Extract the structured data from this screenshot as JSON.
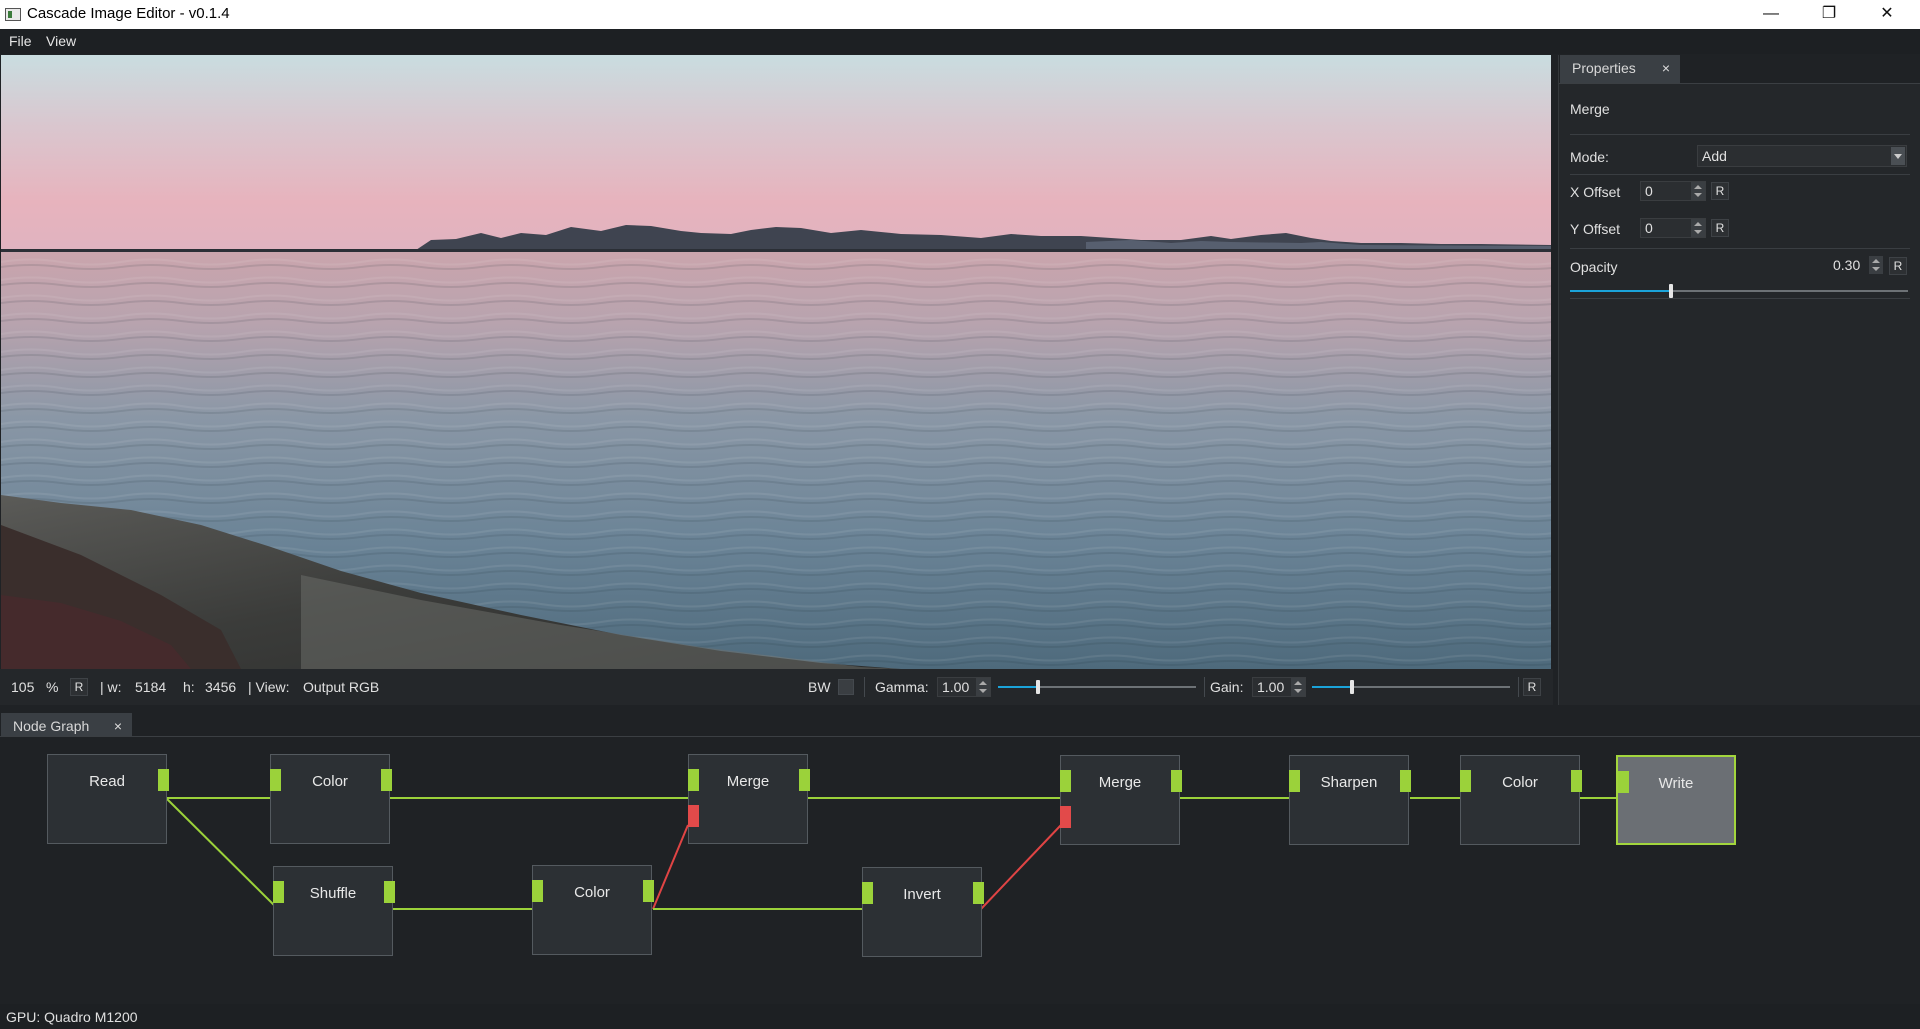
{
  "window": {
    "title": "Cascade Image Editor - v0.1.4"
  },
  "window_controls": {
    "minimize": "—",
    "maximize": "❐",
    "close": "✕"
  },
  "menu": {
    "items": [
      "File",
      "View"
    ]
  },
  "viewer_toolbar": {
    "zoom_value": "105",
    "zoom_unit": "%",
    "reset_label": "R",
    "width_label": "| w:",
    "width_value": "5184",
    "height_label": "h:",
    "height_value": "3456",
    "view_label": "| View:",
    "view_value": "Output RGB",
    "bw_label": "BW",
    "gamma_label": "Gamma:",
    "gamma_value": "1.00",
    "gamma_level": 0.2,
    "gain_label": "Gain:",
    "gain_value": "1.00",
    "gain_level": 0.2,
    "reset_all_label": "R"
  },
  "properties": {
    "tab_label": "Properties",
    "tab_close": "×",
    "node_name": "Merge",
    "mode_label": "Mode:",
    "mode_value": "Add",
    "x_offset_label": "X Offset",
    "x_offset_value": "0",
    "y_offset_label": "Y Offset",
    "y_offset_value": "0",
    "opacity_label": "Opacity",
    "opacity_value": "0.30",
    "opacity_level": 0.3,
    "reset_label": "R"
  },
  "node_graph": {
    "tab_label": "Node Graph",
    "tab_close": "×",
    "nodes": [
      "Read",
      "Color",
      "Merge",
      "Merge",
      "Sharpen",
      "Color",
      "Write",
      "Shuffle",
      "Color",
      "Invert"
    ]
  },
  "status": {
    "gpu": "GPU: Quadro M1200"
  },
  "colors": {
    "accent": "#1ba3d9",
    "port_green": "#9bd23a",
    "port_red": "#e24a4a",
    "wire_green": "#9bd23a",
    "wire_red": "#e04444"
  }
}
